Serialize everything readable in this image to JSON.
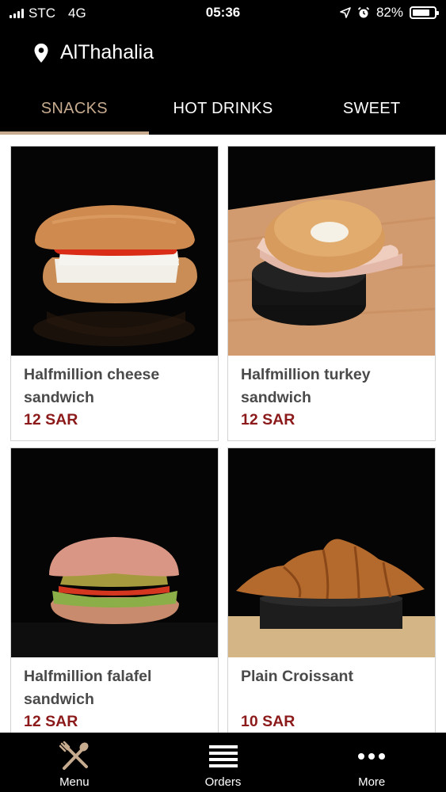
{
  "status_bar": {
    "carrier": "STC",
    "network": "4G",
    "time": "05:36",
    "battery": "82%",
    "battery_level": 0.82
  },
  "location": {
    "name": "AlThahalia",
    "icon": "location-pin-icon"
  },
  "tabs": [
    {
      "label": "SNACKS",
      "active": true
    },
    {
      "label": "HOT DRINKS",
      "active": false
    },
    {
      "label": "SWEET",
      "active": false
    }
  ],
  "products": [
    {
      "name": "Halfmillion cheese sandwich",
      "price": "12 SAR"
    },
    {
      "name": "Halfmillion turkey sandwich",
      "price": "12 SAR"
    },
    {
      "name": "Halfmillion falafel sandwich",
      "price": "12 SAR"
    },
    {
      "name": "Plain Croissant",
      "price": "10 SAR"
    }
  ],
  "bottom_nav": [
    {
      "label": "Menu",
      "icon": "fork-spoon-icon"
    },
    {
      "label": "Orders",
      "icon": "list-lines-icon"
    },
    {
      "label": "More",
      "icon": "more-dots-icon"
    }
  ],
  "colors": {
    "background_dark": "#000000",
    "accent": "#c6ab8f",
    "price": "#8c1a1a"
  }
}
